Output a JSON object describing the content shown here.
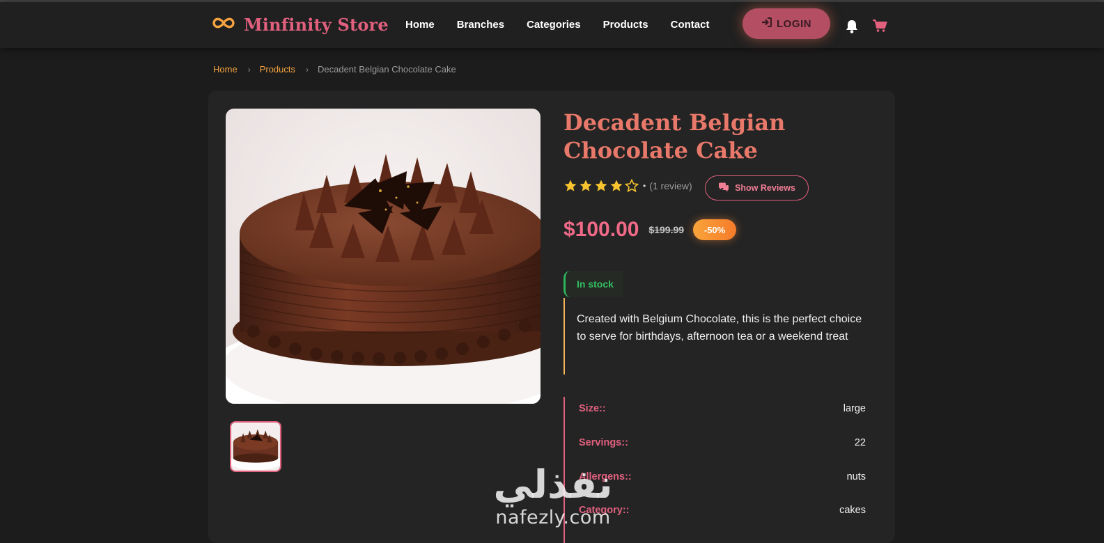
{
  "header": {
    "brand": "Minfinity Store",
    "nav": [
      "Home",
      "Branches",
      "Categories",
      "Products",
      "Contact"
    ],
    "login_label": "LOGIN"
  },
  "breadcrumb": {
    "home": "Home",
    "products": "Products",
    "current": "Decadent Belgian Chocolate Cake",
    "separator": "›"
  },
  "product": {
    "title": "Decadent Belgian Chocolate Cake",
    "rating": 4,
    "rating_max": 5,
    "rating_dot": "•",
    "review_count": "(1 review)",
    "show_reviews_label": "Show Reviews",
    "price": "$100.00",
    "old_price": "$199.99",
    "discount": "-50%",
    "stock": "In stock",
    "description": "Created with Belgium Chocolate, this is the perfect choice to serve for birthdays, afternoon tea or a weekend treat",
    "specs": [
      {
        "label": "Size::",
        "value": "large"
      },
      {
        "label": "Servings::",
        "value": "22"
      },
      {
        "label": "Allergens::",
        "value": "nuts"
      },
      {
        "label": "Category::",
        "value": "cakes"
      }
    ]
  },
  "watermark": {
    "arabic": "نفذلي",
    "latin": "nafezly.com"
  },
  "colors": {
    "brand": "#e0607e",
    "accent_orange": "#f4a340",
    "price": "#f06a88",
    "title": "#e8786a",
    "stock_green": "#32c061",
    "star": "#f7c32e"
  },
  "icons": {
    "logo": "infinity-icon",
    "login": "sign-in-icon",
    "bell": "bell-icon",
    "cart": "cart-icon",
    "reviews": "comments-icon"
  }
}
